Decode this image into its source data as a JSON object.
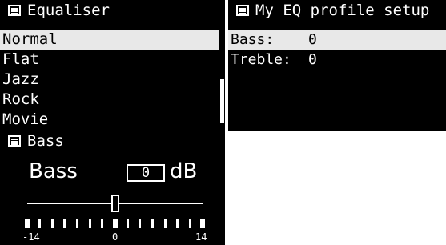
{
  "equaliser": {
    "title": "Equaliser",
    "items": [
      "Normal",
      "Flat",
      "Jazz",
      "Rock",
      "Movie"
    ],
    "selected_index": 0
  },
  "profile": {
    "title": "My EQ profile setup",
    "rows": [
      {
        "label": "Bass:",
        "value": "0"
      },
      {
        "label": "Treble:",
        "value": "0"
      }
    ],
    "selected_index": 0
  },
  "bass": {
    "title": "Bass",
    "label": "Bass",
    "value": "0",
    "unit": "dB",
    "min": -14,
    "max": 14,
    "current": 0,
    "scale_min_label": "-14",
    "scale_mid_label": "0",
    "scale_max_label": "14"
  }
}
